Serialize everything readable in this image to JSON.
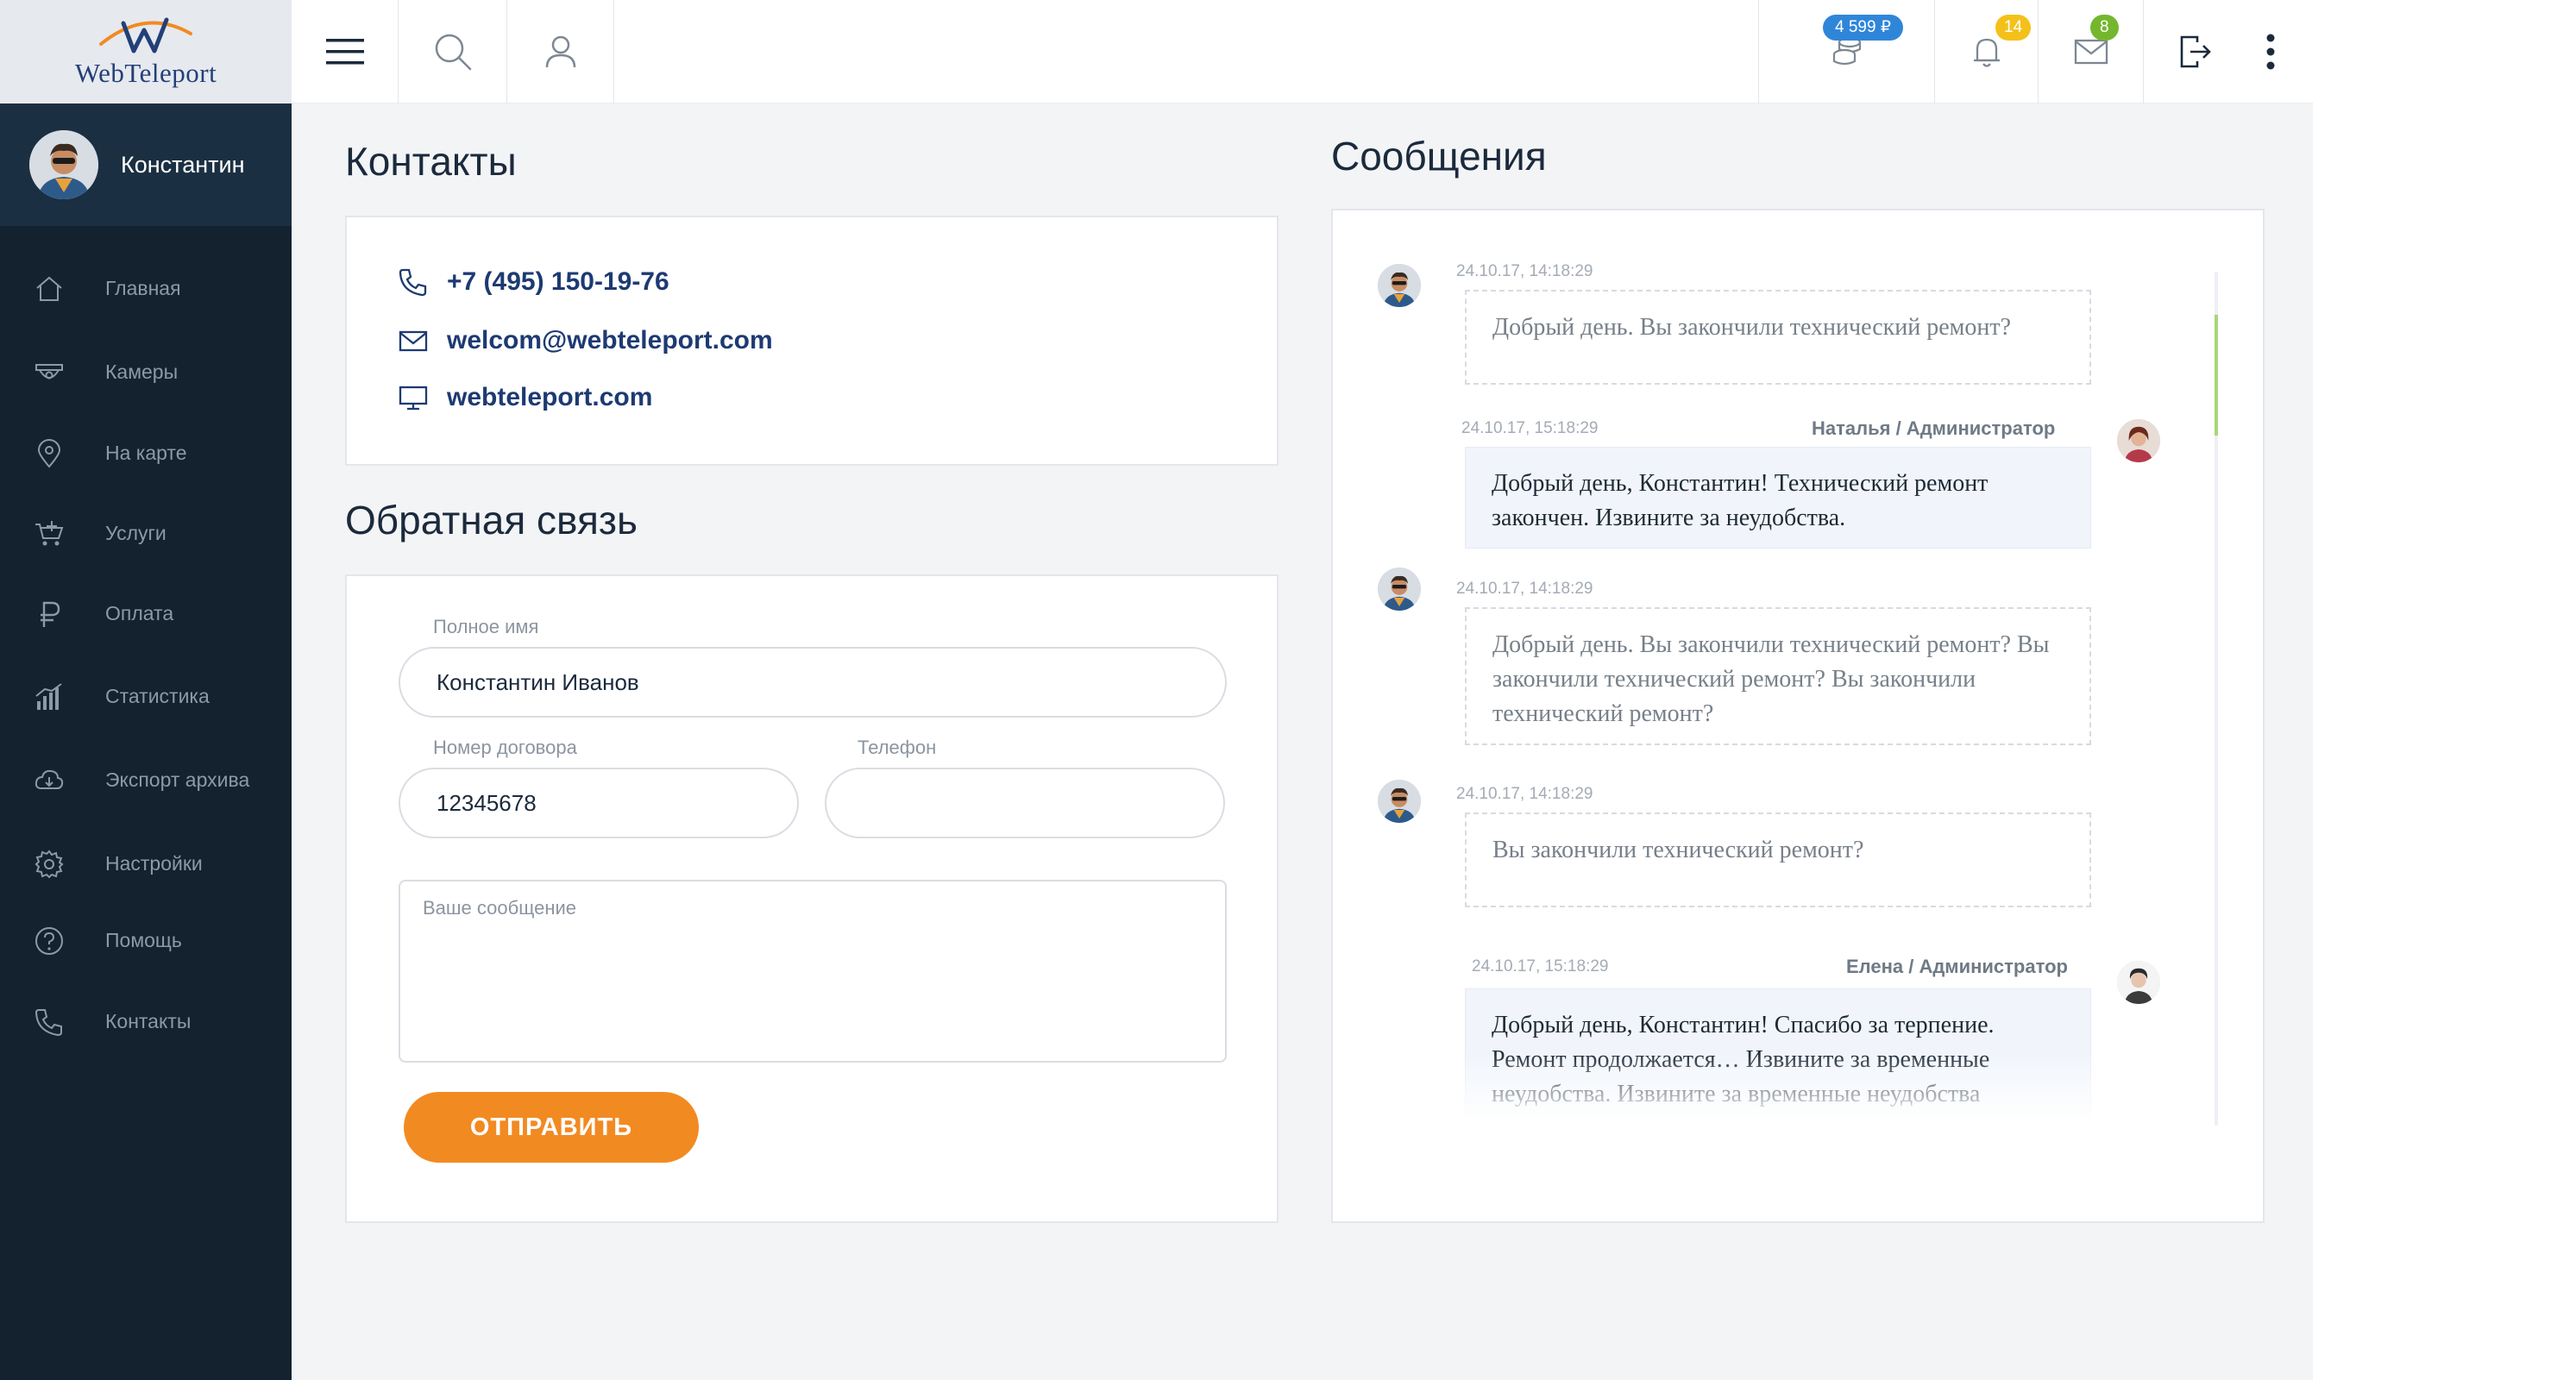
{
  "brand": {
    "name": "WebTeleport"
  },
  "topbar": {
    "balance": "4 599 ₽",
    "notifications_count": "14",
    "messages_count": "8",
    "colors": {
      "balance_badge": "#2f86d9",
      "notif_badge": "#f4c11a",
      "mail_badge": "#74b72e"
    }
  },
  "sidebar": {
    "user_name": "Константин",
    "items": [
      {
        "label": "Главная",
        "icon": "home-icon"
      },
      {
        "label": "Камеры",
        "icon": "camera-icon"
      },
      {
        "label": "На карте",
        "icon": "map-pin-icon"
      },
      {
        "label": "Услуги",
        "icon": "cart-icon"
      },
      {
        "label": "Оплата",
        "icon": "ruble-icon"
      },
      {
        "label": "Статистика",
        "icon": "stats-icon"
      },
      {
        "label": "Экспорт архива",
        "icon": "cloud-download-icon"
      },
      {
        "label": "Настройки",
        "icon": "gear-icon"
      },
      {
        "label": "Помощь",
        "icon": "help-icon"
      },
      {
        "label": "Контакты",
        "icon": "phone-icon"
      }
    ]
  },
  "contacts": {
    "title": "Контакты",
    "phone": "+7 (495) 150-19-76",
    "email": "welcom@webteleport.com",
    "site": "webteleport.com"
  },
  "feedback": {
    "title": "Обратная связь",
    "full_name_label": "Полное имя",
    "full_name_value": "Константин Иванов",
    "contract_label": "Номер договора",
    "contract_value": "12345678",
    "phone_label": "Телефон",
    "phone_value": "",
    "message_placeholder": "Ваше сообщение",
    "submit_label": "ОТПРАВИТЬ"
  },
  "messages": {
    "title": "Сообщения",
    "items": [
      {
        "from": "me",
        "time": "24.10.17, 14:18:29",
        "author": "",
        "text": "Добрый день. Вы закончили технический ремонт?"
      },
      {
        "from": "admin",
        "time": "24.10.17, 15:18:29",
        "author": "Наталья / Администратор",
        "text": "Добрый день, Константин! Технический ремонт закончен. Извините за неудобства."
      },
      {
        "from": "me",
        "time": "24.10.17, 14:18:29",
        "author": "",
        "text": "Добрый день. Вы закончили технический ремонт? Вы закончили технический ремонт? Вы закончили технический ремонт?"
      },
      {
        "from": "me",
        "time": "24.10.17, 14:18:29",
        "author": "",
        "text": "Вы закончили технический ремонт?"
      },
      {
        "from": "admin",
        "time": "24.10.17, 15:18:29",
        "author": "Елена / Администратор",
        "text": "Добрый день, Константин! Спасибо за терпение. Ремонт продолжается… Извините за временные неудобства. Извините за временные неудобства"
      }
    ]
  }
}
